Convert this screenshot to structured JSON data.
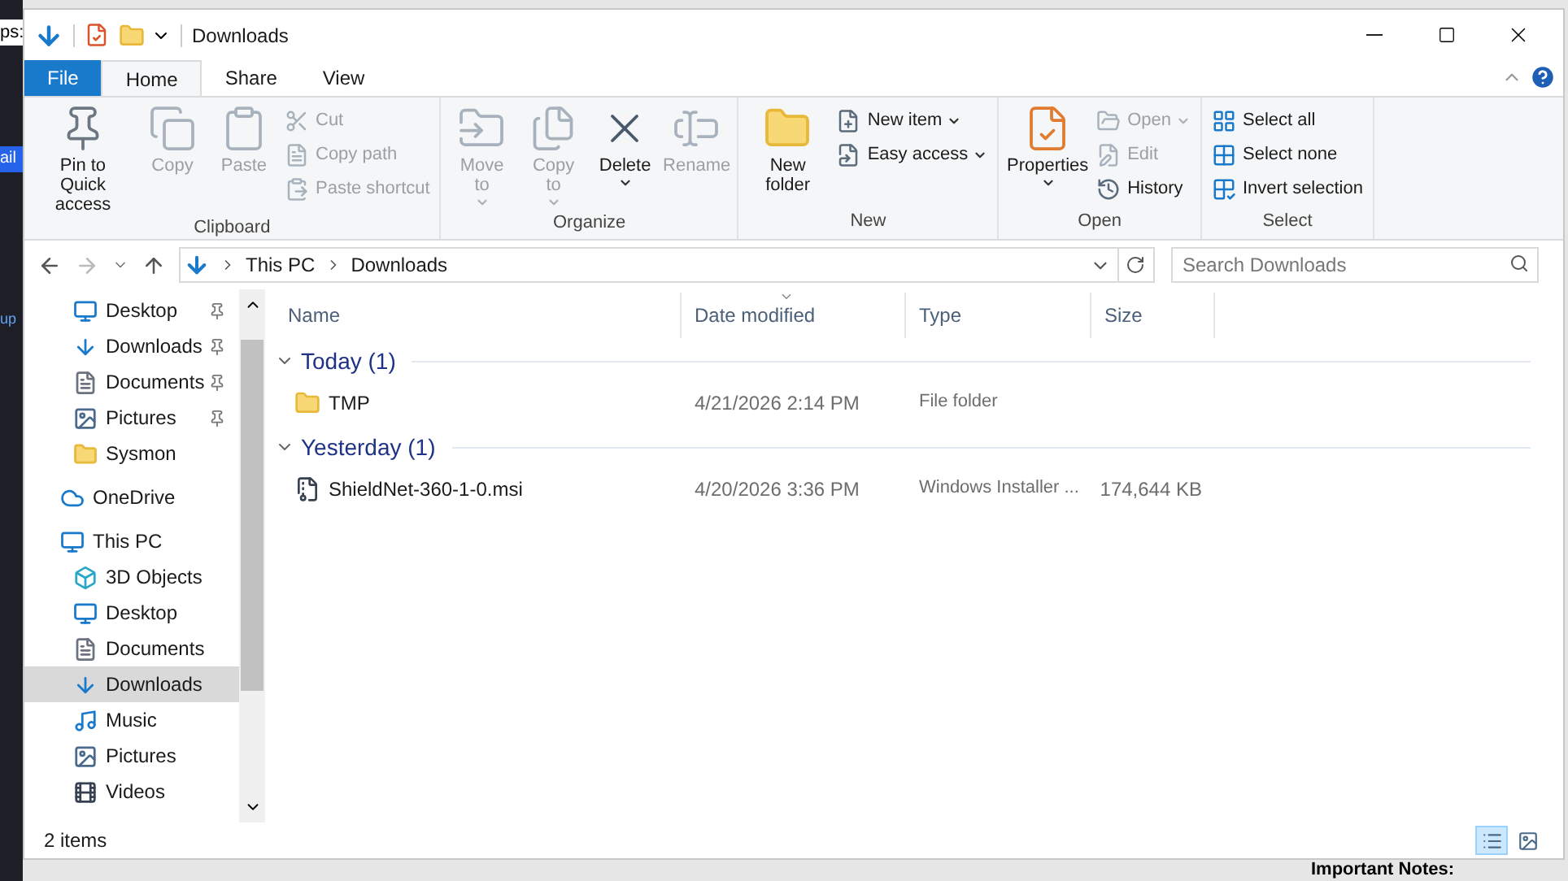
{
  "background": {
    "side_texts": [
      "ps:",
      "ail",
      "up"
    ],
    "footer_text": "Important Notes:"
  },
  "window": {
    "title": "Downloads"
  },
  "ribbon_tabs": [
    {
      "label": "File",
      "kind": "file",
      "selected": false
    },
    {
      "label": "Home",
      "kind": "tab",
      "selected": true
    },
    {
      "label": "Share",
      "kind": "tab",
      "selected": false
    },
    {
      "label": "View",
      "kind": "tab",
      "selected": false
    }
  ],
  "ribbon_groups": [
    {
      "label": "Clipboard",
      "large": [
        {
          "label": "Pin to Quick access",
          "disabled": false,
          "dropdown": false
        },
        {
          "label": "Copy",
          "disabled": true,
          "dropdown": false
        },
        {
          "label": "Paste",
          "disabled": true,
          "dropdown": false
        }
      ],
      "small": [
        {
          "label": "Cut",
          "disabled": true,
          "dropdown": false
        },
        {
          "label": "Copy path",
          "disabled": true,
          "dropdown": false
        },
        {
          "label": "Paste shortcut",
          "disabled": true,
          "dropdown": false
        }
      ]
    },
    {
      "label": "Organize",
      "large": [
        {
          "label": "Move to",
          "disabled": true,
          "dropdown": true
        },
        {
          "label": "Copy to",
          "disabled": true,
          "dropdown": true
        },
        {
          "label": "Delete",
          "disabled": false,
          "dropdown": true
        },
        {
          "label": "Rename",
          "disabled": true,
          "dropdown": false
        }
      ]
    },
    {
      "label": "New",
      "large": [
        {
          "label": "New folder",
          "disabled": false,
          "dropdown": false
        }
      ],
      "small": [
        {
          "label": "New item",
          "disabled": false,
          "dropdown": true
        },
        {
          "label": "Easy access",
          "disabled": false,
          "dropdown": true
        }
      ]
    },
    {
      "label": "Open",
      "large": [
        {
          "label": "Properties",
          "disabled": false,
          "dropdown": true
        }
      ],
      "small": [
        {
          "label": "Open",
          "disabled": true,
          "dropdown": true
        },
        {
          "label": "Edit",
          "disabled": true,
          "dropdown": false
        },
        {
          "label": "History",
          "disabled": false,
          "dropdown": false
        }
      ]
    },
    {
      "label": "Select",
      "small": [
        {
          "label": "Select all",
          "disabled": false,
          "dropdown": false
        },
        {
          "label": "Select none",
          "disabled": false,
          "dropdown": false
        },
        {
          "label": "Invert selection",
          "disabled": false,
          "dropdown": false
        }
      ]
    }
  ],
  "address": {
    "breadcrumb": [
      "This PC",
      "Downloads"
    ]
  },
  "search": {
    "placeholder": "Search Downloads"
  },
  "quick_access": [
    {
      "label": "Desktop",
      "pinned": true,
      "selected": false
    },
    {
      "label": "Downloads",
      "pinned": true,
      "selected": false
    },
    {
      "label": "Documents",
      "pinned": true,
      "selected": false
    },
    {
      "label": "Pictures",
      "pinned": true,
      "selected": false
    },
    {
      "label": "Sysmon",
      "pinned": false,
      "selected": false
    }
  ],
  "nav_tree": [
    {
      "label": "OneDrive",
      "selected": false
    },
    {
      "label": "This PC",
      "selected": false,
      "children": [
        {
          "label": "3D Objects",
          "selected": false
        },
        {
          "label": "Desktop",
          "selected": false
        },
        {
          "label": "Documents",
          "selected": false
        },
        {
          "label": "Downloads",
          "selected": true
        },
        {
          "label": "Music",
          "selected": false
        },
        {
          "label": "Pictures",
          "selected": false
        },
        {
          "label": "Videos",
          "selected": false
        }
      ]
    }
  ],
  "columns": [
    {
      "label": "Name",
      "sorted": false
    },
    {
      "label": "Date modified",
      "sorted": true
    },
    {
      "label": "Type",
      "sorted": false
    },
    {
      "label": "Size",
      "sorted": false
    }
  ],
  "file_groups": [
    {
      "label": "Today (1)",
      "expanded": true,
      "rows": [
        {
          "kind": "folder",
          "name": "TMP",
          "date": "4/21/2026 2:14 PM",
          "type": "File folder"
        }
      ]
    },
    {
      "label": "Yesterday (1)",
      "expanded": true,
      "rows": [
        {
          "kind": "installer",
          "name": "ShieldNet-360-1-0.msi",
          "date": "4/20/2026 3:36 PM",
          "type": "Windows Installer ...",
          "size": "174,644 KB"
        }
      ]
    }
  ],
  "status_bar": {
    "count": "2 items",
    "views": [
      {
        "kind": "details",
        "selected": true
      },
      {
        "kind": "large_icons",
        "selected": false
      }
    ]
  }
}
